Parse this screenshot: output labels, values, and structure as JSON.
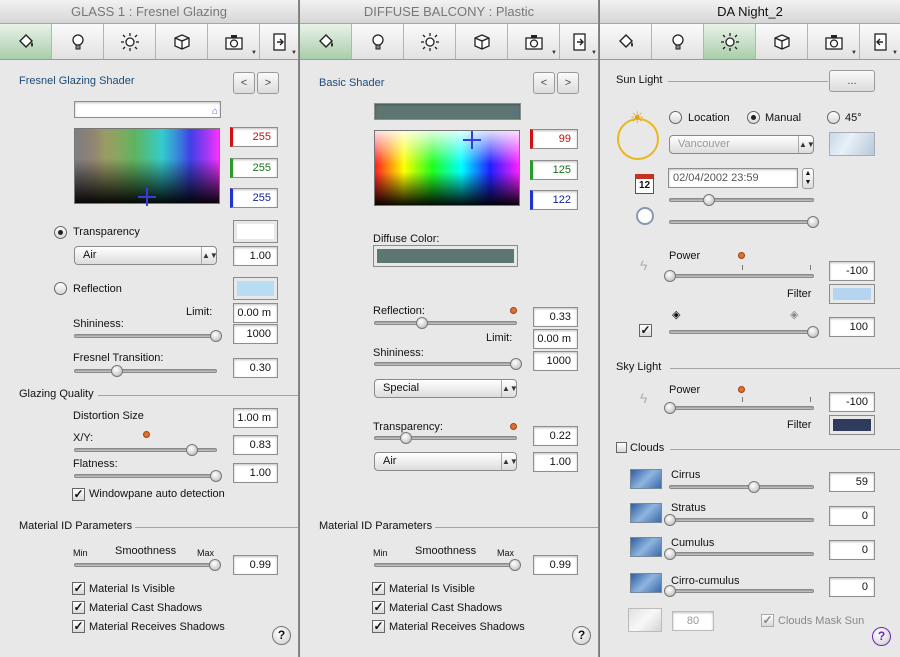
{
  "panel1": {
    "title": "GLASS 1 : Fresnel Glazing",
    "shader_label": "Fresnel Glazing Shader",
    "prev": "<",
    "next": ">",
    "rgb": {
      "r": "255",
      "g": "255",
      "b": "255"
    },
    "transparency_label": "Transparency",
    "transparency_medium": "Air",
    "transparency_value": "1.00",
    "reflection_label": "Reflection",
    "limit_label": "Limit:",
    "limit_value": "0.00 m",
    "shininess_label": "Shininess:",
    "shininess_value": "1000",
    "fresnel_label": "Fresnel Transition:",
    "fresnel_value": "0.30",
    "glazing_quality": "Glazing Quality",
    "distortion_label": "Distortion Size",
    "distortion_value": "1.00 m",
    "xy_label": "X/Y:",
    "xy_value": "0.83",
    "flatness_label": "Flatness:",
    "flatness_value": "1.00",
    "windowpane_label": "Windowpane auto detection",
    "material_id": "Material ID Parameters",
    "min": "Min",
    "smoothness": "Smoothness",
    "max": "Max",
    "smoothness_value": "0.99",
    "visible": "Material Is Visible",
    "cast": "Material Cast Shadows",
    "receives": "Material Receives Shadows",
    "help": "?"
  },
  "panel2": {
    "title": "DIFFUSE BALCONY : Plastic",
    "shader_label": "Basic Shader",
    "prev": "<",
    "next": ">",
    "rgb": {
      "r": "99",
      "g": "125",
      "b": "122"
    },
    "diffuse_label": "Diffuse Color:",
    "reflection_label": "Reflection:",
    "reflection_value": "0.33",
    "limit_label": "Limit:",
    "limit_value": "0.00 m",
    "shininess_label": "Shininess:",
    "shininess_value": "1000",
    "mode": "Special",
    "transparency_label": "Transparency:",
    "transparency_value": "0.22",
    "medium": "Air",
    "medium_value": "1.00",
    "material_id": "Material ID Parameters",
    "min": "Min",
    "smoothness": "Smoothness",
    "max": "Max",
    "smoothness_value": "0.99",
    "visible": "Material Is Visible",
    "cast": "Material Cast Shadows",
    "receives": "Material Receives Shadows",
    "help": "?"
  },
  "panel3": {
    "title": "DA Night_2",
    "sun_light": "Sun Light",
    "more": "...",
    "location": "Location",
    "manual": "Manual",
    "deg": "45°",
    "city": "Vancouver",
    "datetime": "02/04/2002 23:59",
    "calendar_day": "12",
    "power_label": "Power",
    "sun_power_value": "-100",
    "filter_label": "Filter",
    "shadow_value": "100",
    "sky_light": "Sky Light",
    "sky_power_value": "-100",
    "clouds": "Clouds",
    "cirrus": "Cirrus",
    "cirrus_value": "59",
    "stratus": "Stratus",
    "stratus_value": "0",
    "cumulus": "Cumulus",
    "cumulus_value": "0",
    "cirrocumulus": "Cirro-cumulus",
    "cirrocumulus_value": "0",
    "mask_value": "80",
    "mask_label": "Clouds Mask Sun",
    "help": "?"
  },
  "colors": {
    "diffuse": "#5e7672",
    "filter_sun": "#b4d4f0",
    "filter_sky": "#2e3b5c",
    "reflection_swatch": "#b7ddf3",
    "transparency_swatch": "#ffffff",
    "tab_selected": "#a9cfa9"
  },
  "icons": [
    "paint-bucket-icon",
    "light-bulb-icon",
    "sun-icon",
    "cube-icon",
    "camera-icon",
    "export-icon",
    "import-icon"
  ],
  "sliders": {
    "p1_shininess": 1.0,
    "p1_fresnel": 0.3,
    "p1_xy": 0.83,
    "p1_flatness": 1.0,
    "p1_smoothness": 0.99,
    "p2_reflection": 0.33,
    "p2_shininess": 1.0,
    "p2_transparency": 0.22,
    "p2_smoothness": 0.99,
    "p3_date": 0.27,
    "p3_time": 1.0,
    "p3_sun_power": 0.0,
    "p3_shadow": 1.0,
    "p3_sky_power": 0.0,
    "p3_cirrus": 0.59,
    "p3_stratus": 0.0,
    "p3_cumulus": 0.0,
    "p3_cirrocumulus": 0.0
  }
}
